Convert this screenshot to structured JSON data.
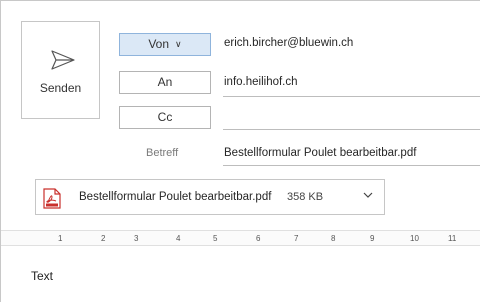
{
  "send_button": {
    "label": "Senden",
    "icon": "send-paper-plane-icon"
  },
  "from": {
    "label": "Von",
    "value": "erich.bircher@bluewin.ch"
  },
  "to": {
    "label": "An",
    "value": "info.heilihof.ch"
  },
  "cc": {
    "label": "Cc",
    "value": ""
  },
  "subject": {
    "label": "Betreff",
    "value": "Bestellformular Poulet bearbeitbar.pdf"
  },
  "attachment": {
    "name": "Bestellformular Poulet bearbeitbar.pdf",
    "size": "358 KB",
    "icon": "pdf-icon"
  },
  "ruler": {
    "numbers": [
      "1",
      "2",
      "3",
      "4",
      "5",
      "6",
      "7",
      "8",
      "9",
      "10",
      "11"
    ]
  },
  "body": {
    "text": "Text"
  },
  "colors": {
    "accent_button": "#dbe8f6",
    "pdf_red": "#c9302c"
  }
}
